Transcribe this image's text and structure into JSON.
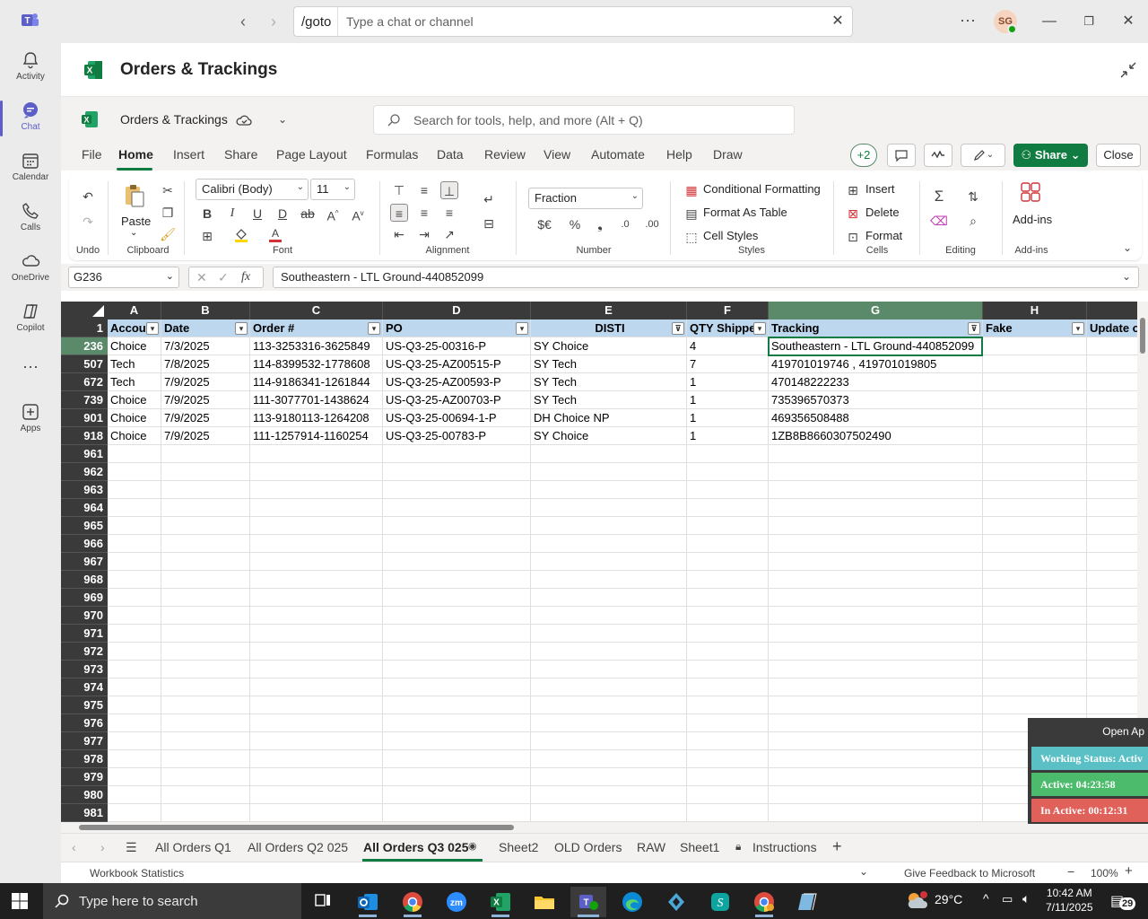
{
  "teams": {
    "goto_label": "/goto",
    "search_placeholder": "Type a chat or channel",
    "avatar_initials": "SG",
    "rail": [
      {
        "label": "Activity",
        "icon": "bell-icon"
      },
      {
        "label": "Chat",
        "icon": "chat-icon"
      },
      {
        "label": "Calendar",
        "icon": "calendar-icon"
      },
      {
        "label": "Calls",
        "icon": "phone-icon"
      },
      {
        "label": "OneDrive",
        "icon": "cloud-icon"
      },
      {
        "label": "Copilot",
        "icon": "copilot-icon"
      },
      {
        "label": "",
        "icon": "more-icon"
      },
      {
        "label": "Apps",
        "icon": "apps-icon"
      }
    ]
  },
  "app": {
    "title": "Orders & Trackings"
  },
  "excel": {
    "doc_name": "Orders & Trackings",
    "search_placeholder": "Search for tools, help, and more (Alt + Q)",
    "menu": [
      "File",
      "Home",
      "Insert",
      "Share",
      "Page Layout",
      "Formulas",
      "Data",
      "Review",
      "View",
      "Automate",
      "Help",
      "Draw"
    ],
    "collab_count": "+2",
    "share_label": "Share",
    "close_label": "Close",
    "ribbon": {
      "undo_label": "Undo",
      "paste_label": "Paste",
      "clipboard_label": "Clipboard",
      "font_name": "Calibri (Body)",
      "font_size": "11",
      "font_label": "Font",
      "alignment_label": "Alignment",
      "number_format": "Fraction",
      "number_label": "Number",
      "conditional_formatting": "Conditional Formatting",
      "format_as_table": "Format As Table",
      "cell_styles": "Cell Styles",
      "styles_label": "Styles",
      "insert": "Insert",
      "delete": "Delete",
      "format": "Format",
      "cells_label": "Cells",
      "editing_label": "Editing",
      "addins": "Add-ins",
      "addins_label": "Add-ins"
    },
    "name_box": "G236",
    "formula": "Southeastern - LTL Ground-440852099",
    "columns": [
      "A",
      "B",
      "C",
      "D",
      "E",
      "F",
      "G",
      "H"
    ],
    "header_row_number": "1",
    "header_cells": [
      "Accou",
      "Date",
      "Order #",
      "PO",
      "DISTI",
      "QTY Shipped",
      "Tracking",
      "Fake",
      "Update o"
    ],
    "rows": [
      {
        "n": "236",
        "cells": [
          "Choice",
          "7/3/2025",
          "113-3253316-3625849",
          "US-Q3-25-00316-P",
          "SY Choice",
          "4",
          "Southeastern - LTL Ground-440852099",
          "",
          ""
        ]
      },
      {
        "n": "507",
        "cells": [
          "Tech",
          "7/8/2025",
          "114-8399532-1778608",
          "US-Q3-25-AZ00515-P",
          "SY Tech",
          "7",
          "419701019746 , 419701019805",
          "",
          ""
        ]
      },
      {
        "n": "672",
        "cells": [
          "Tech",
          "7/9/2025",
          "114-9186341-1261844",
          "US-Q3-25-AZ00593-P",
          "SY Tech",
          "1",
          "470148222233",
          "",
          ""
        ]
      },
      {
        "n": "739",
        "cells": [
          "Choice",
          "7/9/2025",
          "111-3077701-1438624",
          "US-Q3-25-AZ00703-P",
          "SY Tech",
          "1",
          "735396570373",
          "",
          ""
        ]
      },
      {
        "n": "901",
        "cells": [
          "Choice",
          "7/9/2025",
          "113-9180113-1264208",
          "US-Q3-25-00694-1-P",
          "DH Choice NP",
          "1",
          "469356508488",
          "",
          ""
        ]
      },
      {
        "n": "918",
        "cells": [
          "Choice",
          "7/9/2025",
          "111-1257914-1160254",
          "US-Q3-25-00783-P",
          "SY Choice",
          "1",
          "1ZB8B8660307502490",
          "",
          ""
        ]
      }
    ],
    "empty_rows": [
      "961",
      "962",
      "963",
      "964",
      "965",
      "966",
      "967",
      "968",
      "969",
      "970",
      "971",
      "972",
      "973",
      "974",
      "975",
      "976",
      "977",
      "978",
      "979",
      "980",
      "981"
    ],
    "sheets": [
      "All Orders Q1",
      "All Orders Q2 025",
      "All Orders Q3 025",
      "Sheet2",
      "OLD Orders",
      "RAW",
      "Sheet1",
      "Instructions"
    ],
    "active_sheet": "All Orders Q3 025",
    "status_left": "Workbook Statistics",
    "feedback": "Give Feedback to Microsoft",
    "zoom": "100%"
  },
  "widget": {
    "open": "Open Ap",
    "working": "Working Status: Activ",
    "active": "Active: 04:23:58",
    "inactive": "In Active: 00:12:31",
    "colors": {
      "working": "#5bc0c6",
      "active": "#4cbb6c",
      "inactive": "#e0605a"
    }
  },
  "taskbar": {
    "search_placeholder": "Type here to search",
    "temperature": "29°C",
    "time": "10:42 AM",
    "date": "7/11/2025",
    "notifications": "29"
  },
  "colors": {
    "excel_green": "#107c41",
    "teams_purple": "#5b5fc7",
    "header_fill": "#bdd7ee"
  }
}
